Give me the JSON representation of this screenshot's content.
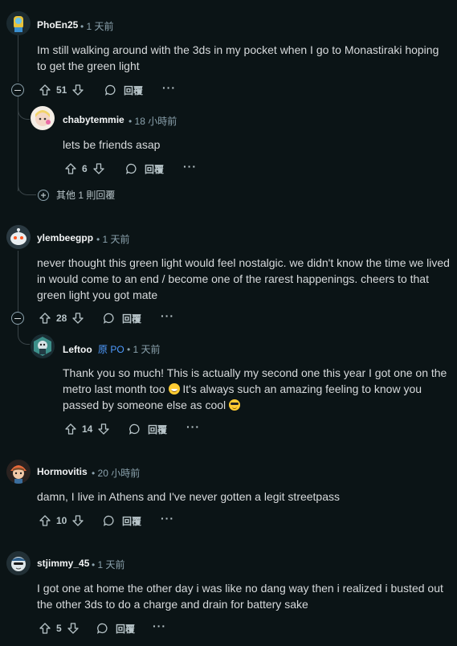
{
  "comments": [
    {
      "author": "PhoEn25",
      "time": "• 1 天前",
      "body": "Im still walking around with the 3ds in my pocket when I go to Monastiraki hoping to get the green light",
      "votes": "51",
      "reply_label": "回覆",
      "more_label": "···"
    },
    {
      "author": "chabytemmie",
      "time": "• 18 小時前",
      "body": "lets be friends asap",
      "votes": "6",
      "reply_label": "回覆",
      "more_label": "···"
    },
    {
      "author": "ylembeegpp",
      "time": "• 1 天前",
      "body": "never thought this green light would feel nostalgic. we didn't know the time we lived in would come to an end / become one of the rarest happenings. cheers to that green light you got mate",
      "votes": "28",
      "reply_label": "回覆",
      "more_label": "···"
    },
    {
      "author": "Leftoo",
      "op_badge": "原 PO",
      "time": "• 1 天前",
      "body_part1": "Thank you so much! This is actually my second one this year I got one on the metro last month too ",
      "body_part2": " It's always such an amazing feeling to know you passed by someone else as cool ",
      "votes": "14",
      "reply_label": "回覆",
      "more_label": "···"
    },
    {
      "author": "Hormovitis",
      "time": "• 20 小時前",
      "body": "damn, I live in Athens and I've never gotten a legit streetpass",
      "votes": "10",
      "reply_label": "回覆",
      "more_label": "···"
    },
    {
      "author": "stjimmy_45",
      "time": "• 1 天前",
      "body": "I got one at home the other day i was like no dang way then i realized i busted out the other 3ds to do a charge and drain for battery sake",
      "votes": "5",
      "reply_label": "回覆",
      "more_label": "···"
    }
  ],
  "more_replies_label": "其他 1 則回覆",
  "colors": {
    "background": "#0b1416",
    "op_badge": "#4f9bff",
    "meta": "#8ba2ad"
  }
}
